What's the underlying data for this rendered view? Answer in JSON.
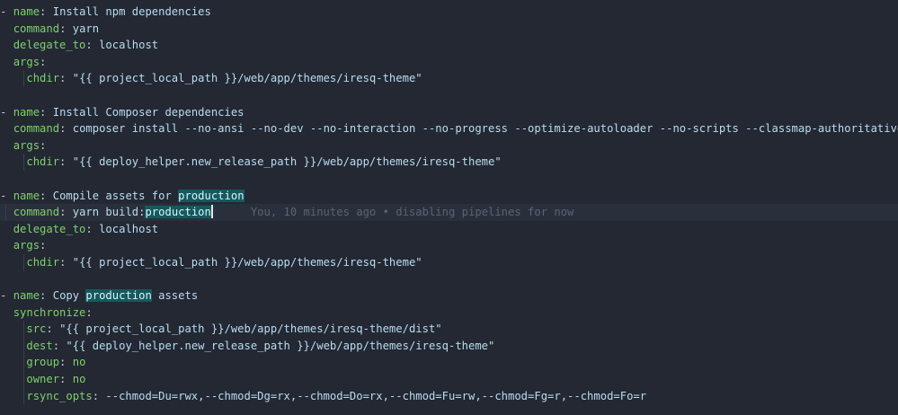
{
  "blame": "You, 10 minutes ago • disabling pipelines for now",
  "tasks": [
    {
      "name": "Install npm dependencies",
      "command": "yarn",
      "delegate_to": "localhost",
      "chdir": "\"{{ project_local_path }}/web/app/themes/iresq-theme\""
    },
    {
      "name": "Install Composer dependencies",
      "command": "composer install --no-ansi --no-dev --no-interaction --no-progress --optimize-autoloader --no-scripts --classmap-authoritative",
      "chdir": "\"{{ deploy_helper.new_release_path }}/web/app/themes/iresq-theme\""
    },
    {
      "name_prefix": "Compile assets for ",
      "name_hl": "production",
      "command_prefix": "yarn build:",
      "command_hl": "production",
      "delegate_to": "localhost",
      "chdir": "\"{{ project_local_path }}/web/app/themes/iresq-theme\""
    },
    {
      "name_prefix": "Copy ",
      "name_hl": "production",
      "name_suffix": " assets",
      "src": "\"{{ project_local_path }}/web/app/themes/iresq-theme/dist\"",
      "dest": "\"{{ deploy_helper.new_release_path }}/web/app/themes/iresq-theme\"",
      "group": "no",
      "owner": "no",
      "rsync_opts": "--chmod=Du=rwx,--chmod=Dg=rx,--chmod=Do=rx,--chmod=Fu=rw,--chmod=Fg=r,--chmod=Fo=r"
    }
  ],
  "keys": {
    "name": "name",
    "command": "command",
    "delegate_to": "delegate_to",
    "args": "args",
    "chdir": "chdir",
    "synchronize": "synchronize",
    "src": "src",
    "dest": "dest",
    "group": "group",
    "owner": "owner",
    "rsync_opts": "rsync_opts"
  },
  "colors": {
    "background": "#232833",
    "key": "#7fd16b",
    "value": "#b9dcf1",
    "highlight": "#15595c",
    "blame": "#5c6370"
  }
}
